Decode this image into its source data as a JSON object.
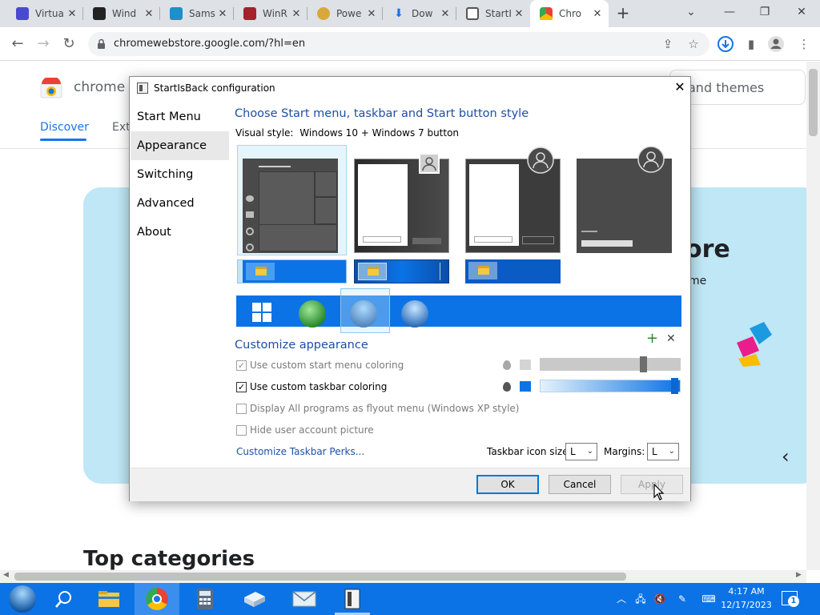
{
  "browser": {
    "tabs": [
      {
        "label": "Virtua",
        "favicon_color": "#4a4ad0",
        "active": false
      },
      {
        "label": "Wind",
        "favicon_color": "#222222",
        "active": false
      },
      {
        "label": "Sams",
        "favicon_color": "#1d8fc9",
        "active": false
      },
      {
        "label": "WinR",
        "favicon_color": "#a5222a",
        "active": false
      },
      {
        "label": "Powe",
        "favicon_color": "#d8a93a",
        "active": false
      },
      {
        "label": "Dow",
        "favicon_color": "#1a73e8",
        "active": false
      },
      {
        "label": "StartI",
        "favicon_color": "#555555",
        "active": false
      },
      {
        "label": "Chro",
        "favicon_color": "#e94235",
        "active": true
      }
    ],
    "new_tab_glyph": "+",
    "close_glyph": "✕",
    "url": "chromewebstore.google.com/?hl=en",
    "window_controls": {
      "dropdown": "⌄",
      "minimize": "—",
      "restore": "❐",
      "close": "✕"
    }
  },
  "page": {
    "store_name": "chrome w",
    "header_right": "and themes",
    "tab_discover": "Discover",
    "tab_ext": "Ext",
    "hero_title": "ore",
    "hero_sub": "me",
    "top_categories": "Top categories",
    "carousel_prev": "‹"
  },
  "dialog": {
    "title": "StartIsBack configuration",
    "close": "✕",
    "sidebar": [
      "Start Menu",
      "Appearance",
      "Switching",
      "Advanced",
      "About"
    ],
    "heading": "Choose Start menu, taskbar and Start button style",
    "visual_style_label": "Visual style:",
    "visual_style_value": "Windows 10 + Windows 7 button",
    "customize_heading": "Customize appearance",
    "add_glyph": "+",
    "remove_glyph": "✕",
    "options": [
      {
        "label": "Use custom start menu coloring",
        "checked": true,
        "enabled": false
      },
      {
        "label": "Use custom taskbar coloring",
        "checked": true,
        "enabled": true
      },
      {
        "label": "Display All programs as flyout menu (Windows XP style)",
        "checked": false,
        "enabled": false
      },
      {
        "label": "Hide user account picture",
        "checked": false,
        "enabled": false
      }
    ],
    "check_glyph": "✓",
    "perks_link": "Customize Taskbar Perks...",
    "icon_size_label": "Taskbar icon size:",
    "icon_size_value": "L",
    "margins_label": "Margins:",
    "margins_value": "L",
    "combo_arrow": "⌄",
    "ok": "OK",
    "cancel": "Cancel",
    "apply": "Apply",
    "start_menu_slider": 0.75,
    "taskbar_slider": 0.98,
    "colors": {
      "accent": "#0b73e6",
      "link": "#1c4fa6",
      "swatch_start": "#d4d4d4",
      "swatch_taskbar": "#0b73e6"
    }
  },
  "taskbar": {
    "time": "4:17 AM",
    "date": "12/17/2023",
    "notification_count": "1",
    "icons": [
      "windows-start-orb",
      "search-icon",
      "file-explorer-icon",
      "chrome-icon",
      "calculator-icon",
      "package-icon",
      "mail-icon",
      "startisback-icon"
    ]
  }
}
